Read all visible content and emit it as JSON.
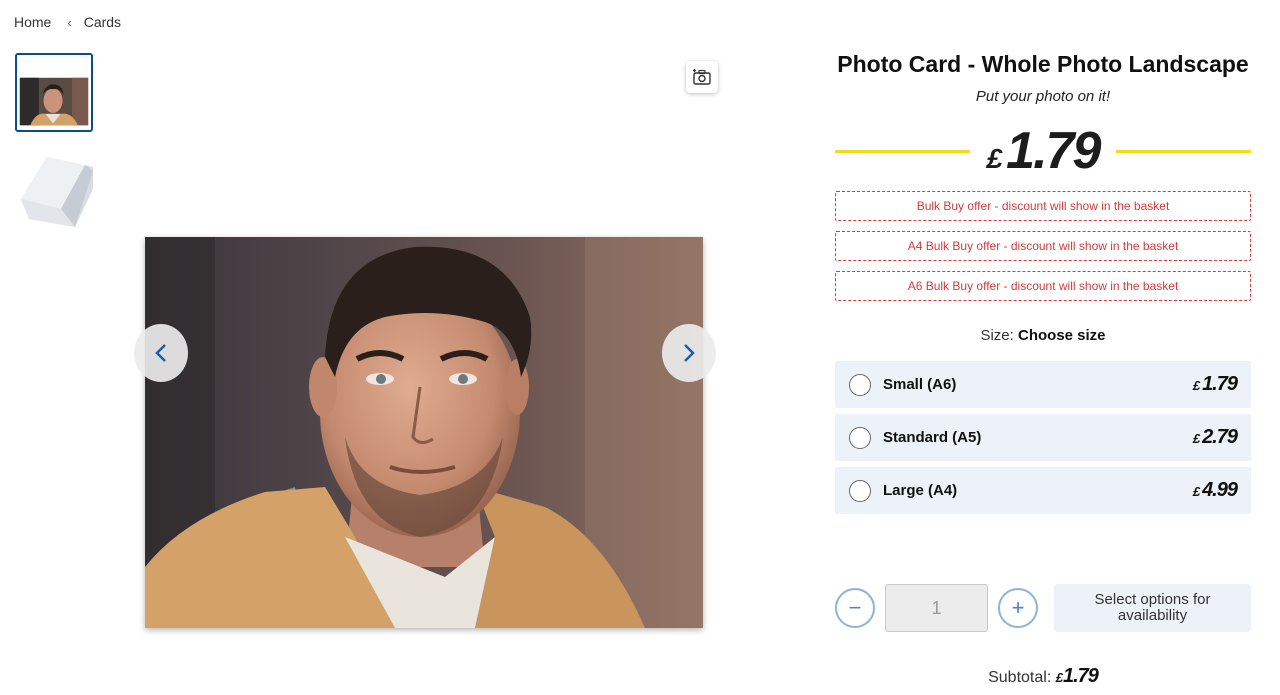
{
  "breadcrumb": {
    "home": "Home",
    "current": "Cards"
  },
  "product": {
    "title": "Photo Card - Whole Photo Landscape",
    "tagline": "Put your photo on it!",
    "price_currency": "£",
    "price_value": "1.79"
  },
  "offers": [
    "Bulk Buy offer - discount will show in the basket",
    "A4 Bulk Buy offer - discount will show in the basket",
    "A6 Bulk Buy offer - discount will show in the basket"
  ],
  "size": {
    "label": "Size:",
    "value": "Choose size"
  },
  "options": [
    {
      "name": "Small (A6)",
      "currency": "£",
      "price": "1.79"
    },
    {
      "name": "Standard (A5)",
      "currency": "£",
      "price": "2.79"
    },
    {
      "name": "Large (A4)",
      "currency": "£",
      "price": "4.99"
    }
  ],
  "quantity": {
    "value": "1",
    "minus": "−",
    "plus": "+"
  },
  "availability_button": "Select options for availability",
  "subtotal": {
    "label": "Subtotal:",
    "currency": "£",
    "value": "1.79"
  },
  "colors": {
    "accent_yellow": "#f1dc1b",
    "offer_red": "#d33c3c",
    "nav_blue": "#1a5fa8",
    "option_bg": "#edf2f8"
  },
  "icons": [
    "chevron-left-icon",
    "camera-icon",
    "arrow-left-icon",
    "arrow-right-icon",
    "minus-icon",
    "plus-icon"
  ]
}
